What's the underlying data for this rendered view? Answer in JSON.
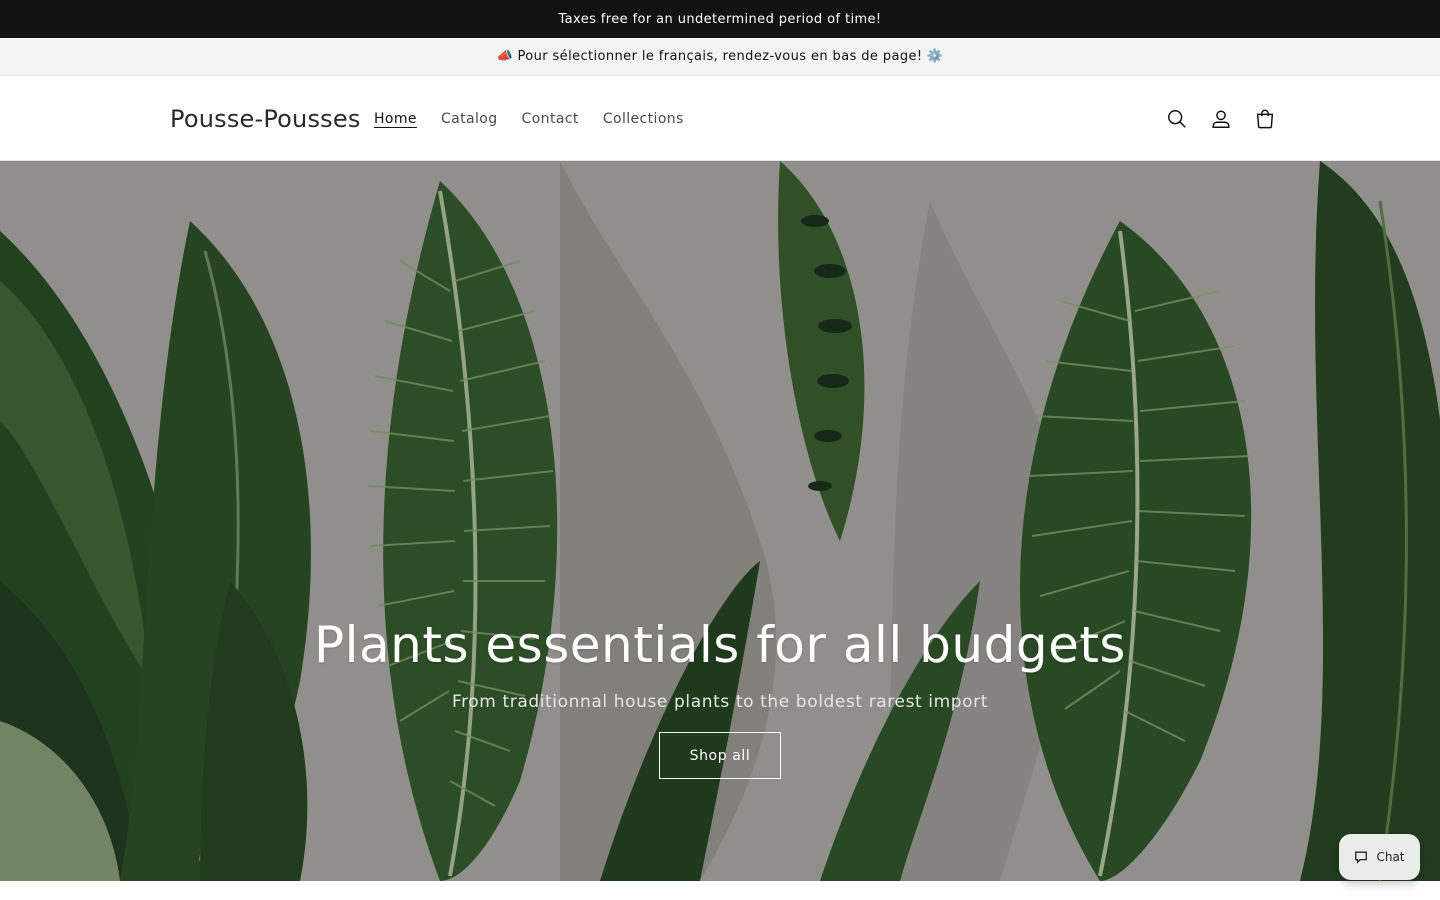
{
  "announcement": {
    "text": "Taxes free for an undetermined period of time!"
  },
  "language_notice": {
    "leading_emoji": "📣",
    "text": "Pour sélectionner le français, rendez-vous en bas de page!",
    "trailing_emoji": "⚙️"
  },
  "header": {
    "logo": "Pousse-Pousses",
    "nav": [
      {
        "label": "Home",
        "active": true
      },
      {
        "label": "Catalog",
        "active": false
      },
      {
        "label": "Contact",
        "active": false
      },
      {
        "label": "Collections",
        "active": false
      }
    ],
    "icons": [
      "search-icon",
      "account-icon",
      "cart-icon"
    ]
  },
  "hero": {
    "title": "Plants essentials for all budgets",
    "subtitle": "From traditionnal house plants to the boldest rarest import",
    "button_label": "Shop all"
  },
  "chat": {
    "label": "Chat",
    "icon": "chat-bubble-icon"
  },
  "colors": {
    "topbar_bg": "#121212",
    "secondbar_bg": "#f3f3f3",
    "leaf_dark": "#1f3a22",
    "leaf_mid": "#3f6a3a",
    "leaf_light": "#7fa06c",
    "wall": "#cfcdc7"
  }
}
